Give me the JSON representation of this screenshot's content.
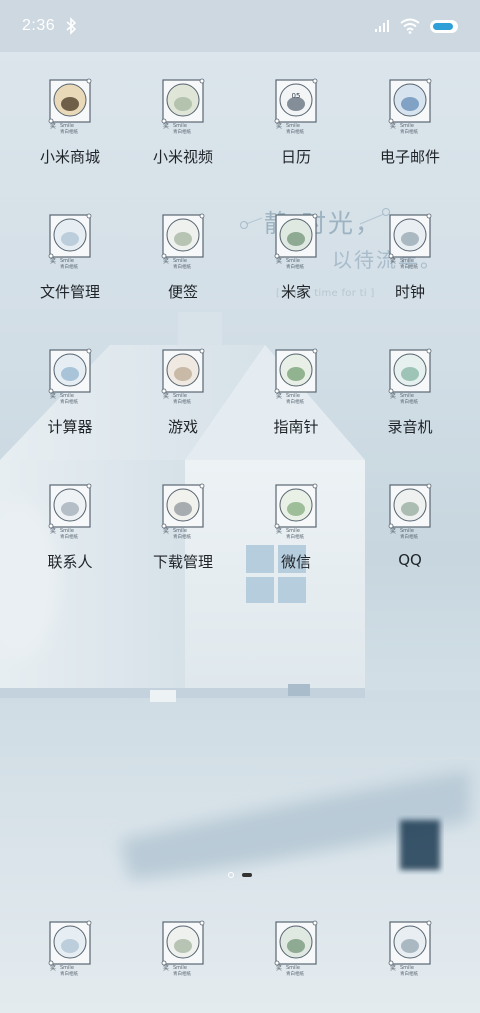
{
  "status_bar": {
    "time": "2:36",
    "battery_level": 0.9
  },
  "wallpaper_quote": {
    "line1": "静 时光，",
    "line2": "以待流年。",
    "line3": "[   quiet time for ti   ]"
  },
  "icon_caption": {
    "top": "Smile",
    "bottom": "青白相纸"
  },
  "apps": [
    {
      "label": "小米商城",
      "icon": "tower-photo-icon"
    },
    {
      "label": "小米视频",
      "icon": "video-photo-icon"
    },
    {
      "label": "日历",
      "icon": "calendar-photo-icon",
      "icon_text": "05"
    },
    {
      "label": "电子邮件",
      "icon": "mail-photo-icon"
    },
    {
      "label": "文件管理",
      "icon": "files-photo-icon"
    },
    {
      "label": "便签",
      "icon": "notes-photo-icon"
    },
    {
      "label": "米家",
      "icon": "home-photo-icon"
    },
    {
      "label": "时钟",
      "icon": "clock-photo-icon"
    },
    {
      "label": "计算器",
      "icon": "calculator-photo-icon"
    },
    {
      "label": "游戏",
      "icon": "game-photo-icon"
    },
    {
      "label": "指南针",
      "icon": "compass-photo-icon"
    },
    {
      "label": "录音机",
      "icon": "recorder-photo-icon"
    },
    {
      "label": "联系人",
      "icon": "contacts-photo-icon"
    },
    {
      "label": "下载管理",
      "icon": "download-photo-icon"
    },
    {
      "label": "微信",
      "icon": "wechat-photo-icon"
    },
    {
      "label": "QQ",
      "icon": "qq-photo-icon"
    }
  ],
  "dock": [
    {
      "icon": "phone-photo-icon"
    },
    {
      "icon": "messages-photo-icon"
    },
    {
      "icon": "browser-photo-icon"
    },
    {
      "icon": "camera-photo-icon"
    }
  ],
  "pager": {
    "pages": 2,
    "current": 2
  }
}
